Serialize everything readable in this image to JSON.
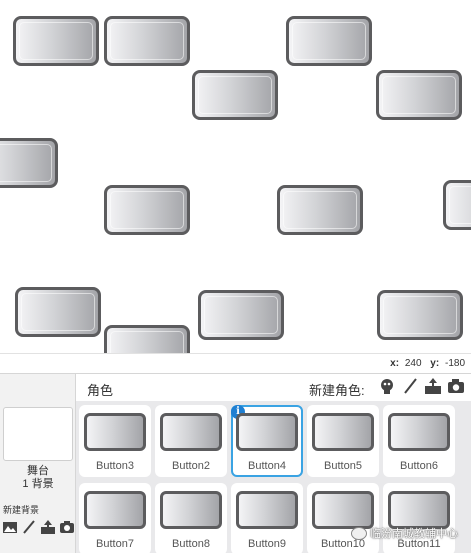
{
  "stage": {
    "coordinates": {
      "x_label": "x:",
      "x_value": "240",
      "y_label": "y:",
      "y_value": "-180"
    }
  },
  "stage_panel": {
    "label": "舞台",
    "backdrop_count": "1 背景",
    "new_backdrop_label": "新建背景",
    "tools": [
      "paint-icon",
      "brush-icon",
      "upload-icon",
      "camera-icon"
    ]
  },
  "sprite_pane": {
    "title": "角色",
    "new_sprite_label": "新建角色:",
    "tools": [
      "sprite-library-icon",
      "brush-icon",
      "upload-icon",
      "camera-icon"
    ],
    "selected": "Button4",
    "sprites": [
      {
        "name": "Button3"
      },
      {
        "name": "Button2"
      },
      {
        "name": "Button4"
      },
      {
        "name": "Button5"
      },
      {
        "name": "Button6"
      },
      {
        "name": "Button7"
      },
      {
        "name": "Button8"
      },
      {
        "name": "Button9"
      },
      {
        "name": "Button10"
      },
      {
        "name": "Button11"
      }
    ]
  },
  "watermark": {
    "text": "临汾南城教辅中心"
  },
  "colors": {
    "selection": "#3aa3e3",
    "info_badge": "#1f7fd2",
    "button_border": "#5c5c5e"
  }
}
